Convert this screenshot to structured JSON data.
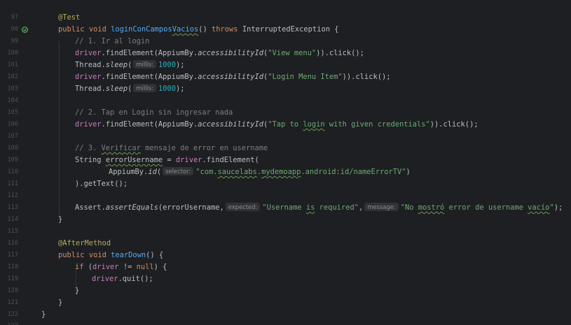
{
  "gutter": {
    "line_numbers": [
      "97",
      "98",
      "99",
      "100",
      "101",
      "102",
      "103",
      "104",
      "105",
      "106",
      "107",
      "108",
      "109",
      "110",
      "111",
      "112",
      "113",
      "114",
      "115",
      "116",
      "117",
      "118",
      "119",
      "120",
      "121",
      "122",
      "123"
    ],
    "run_icon": "run-test-icon"
  },
  "code": {
    "l98_ann": "@Test",
    "l99_public": "public",
    "l99_void": "void",
    "l99_name_a": "loginConCampos",
    "l99_name_b": "Vacios",
    "l99_paren": "()",
    "l99_throws": "throws",
    "l99_rest": "InterruptedException {",
    "l100_comment": "// 1. Ir al login",
    "l101_driver": "driver",
    "l101_a": ".findElement(AppiumBy.",
    "l101_m": "accessibilityId",
    "l101_b": "(",
    "l101_s": "\"View menu\"",
    "l101_c": ")).click();",
    "l102_a": "Thread.",
    "l102_m": "sleep",
    "l102_b": "(",
    "l102_hint": "millis:",
    "l102_n": "1000",
    "l102_c": ");",
    "l103_driver": "driver",
    "l103_a": ".findElement(AppiumBy.",
    "l103_m": "accessibilityId",
    "l103_b": "(",
    "l103_s": "\"Login Menu Item\"",
    "l103_c": ")).click();",
    "l104_a": "Thread.",
    "l104_m": "sleep",
    "l104_b": "(",
    "l104_hint": "millis:",
    "l104_n": "1000",
    "l104_c": ");",
    "l106_comment": "// 2. Tap en Login sin ingresar nada",
    "l107_driver": "driver",
    "l107_a": ".findElement(AppiumBy.",
    "l107_m": "accessibilityId",
    "l107_b": "(",
    "l107_s1": "\"Tap to ",
    "l107_s2": "login",
    "l107_s3": " with given credentials\"",
    "l107_c": ")).click();",
    "l109_c1": "// 3. ",
    "l109_c2": "Verificar",
    "l109_c3": " mensaje de error en username",
    "l110_a": "String",
    "l110_var": "errorUsername",
    "l110_eq": " = ",
    "l110_driver": "driver",
    "l110_b": ".findElement(",
    "l111_a": "AppiumBy.",
    "l111_m": "id",
    "l111_b": "(",
    "l111_hint": "selector:",
    "l111_s1": "\"com.",
    "l111_s2": "saucelabs",
    "l111_s3": ".",
    "l111_s4": "mydemoapp",
    "l111_s5": ".android:id/nameErrorTV\"",
    "l111_c": ")",
    "l112_a": ").getText();",
    "l114_a": "Assert.",
    "l114_m": "assertEquals",
    "l114_b": "(errorUsername,",
    "l114_hint1": "expected:",
    "l114_s1": "\"Username ",
    "l114_s1b": "is",
    "l114_s1c": " required\"",
    "l114_comma": ",",
    "l114_hint2": "message:",
    "l114_s2a": "\"No ",
    "l114_s2b": "mostró",
    "l114_s2c": " error de username ",
    "l114_s2d": "vacío",
    "l114_s2e": "\"",
    "l114_c": ");",
    "l115": "}",
    "l117_ann": "@AfterMethod",
    "l118_public": "public",
    "l118_void": "void",
    "l118_name": "tearDown",
    "l118_rest": "() {",
    "l119_if": "if",
    "l119_a": " (",
    "l119_driver": "driver",
    "l119_b": " != ",
    "l119_null": "null",
    "l119_c": ") {",
    "l120_driver": "driver",
    "l120_a": ".quit();",
    "l121": "}",
    "l122": "}",
    "l123": "}"
  },
  "colors": {
    "background": "#1e1f22",
    "keyword": "#cf8e6d",
    "annotation": "#b3ae60",
    "method": "#56a8f5",
    "field": "#c77dbb",
    "string": "#6aab73",
    "number": "#2aacb8",
    "comment": "#7a7e85"
  }
}
